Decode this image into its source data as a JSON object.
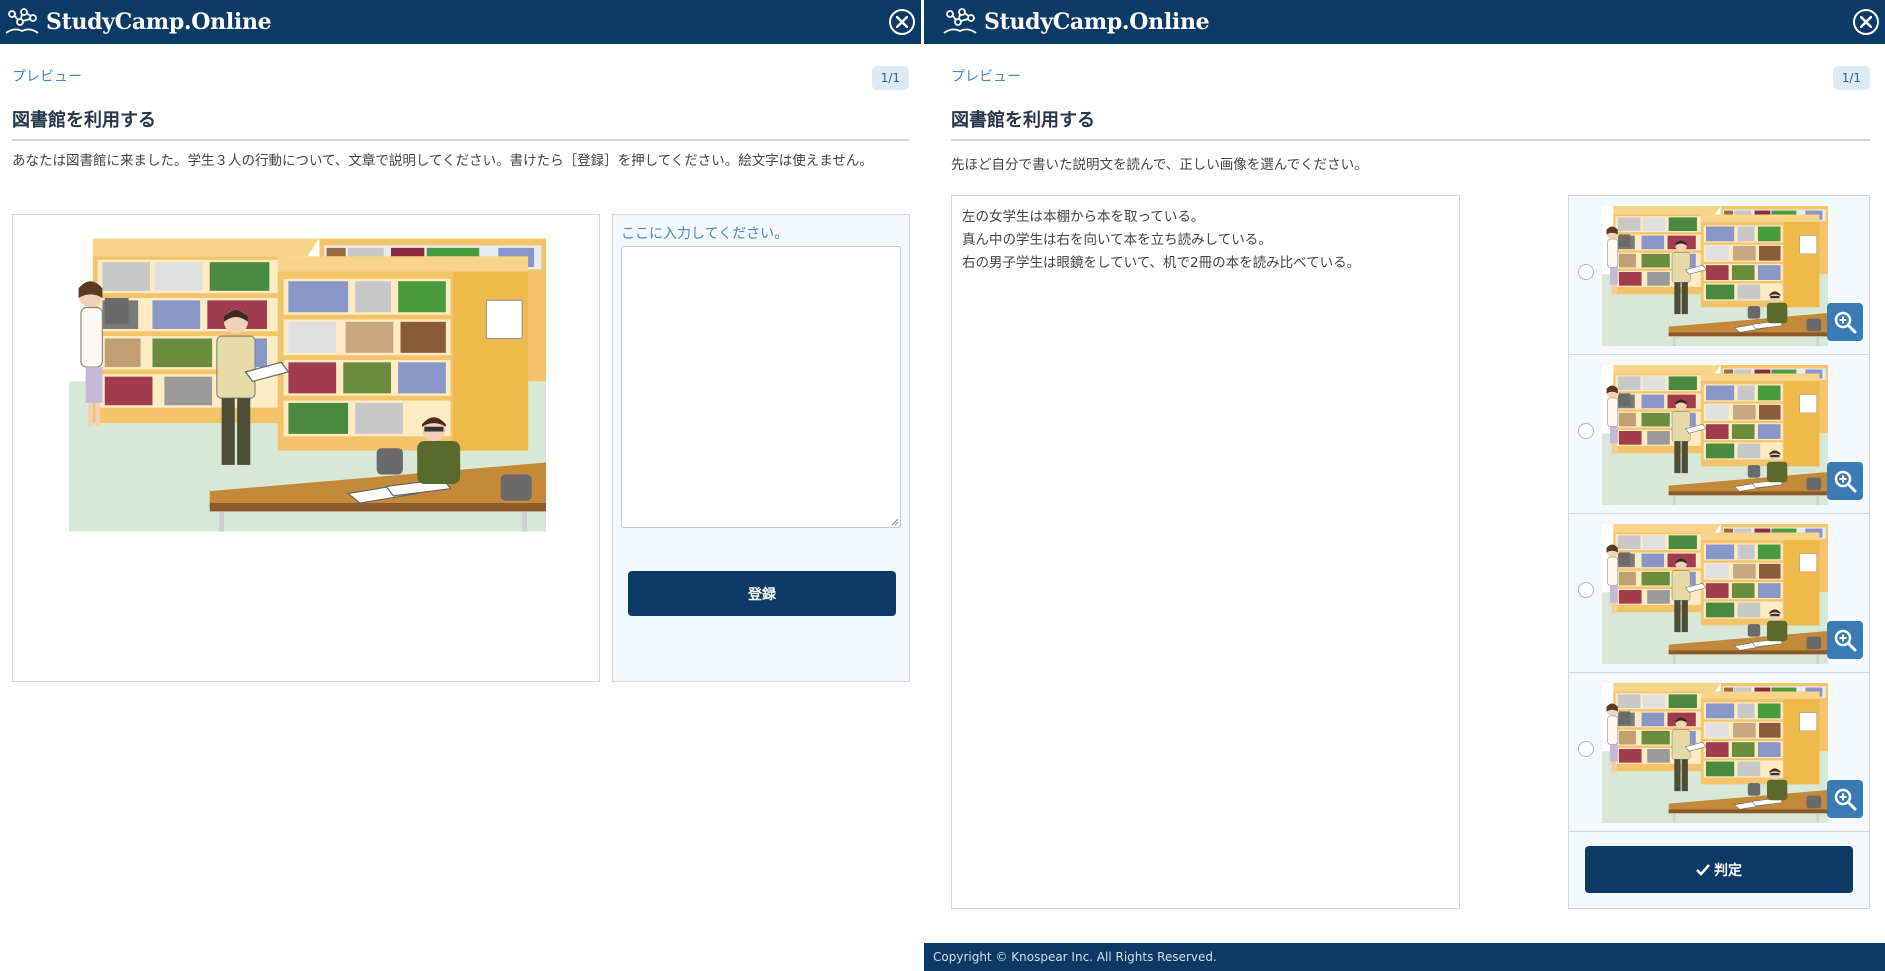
{
  "app": {
    "brand": "StudyCamp.Online"
  },
  "left": {
    "breadcrumb": "プレビュー",
    "pager": "1/1",
    "title": "図書館を利用する",
    "instruction": "あなたは図書館に来ました。学生３人の行動について、文章で説明してください。書けたら［登録］を押してください。絵文字は使えません。",
    "input_label": "ここに入力してください。",
    "answer_value": "",
    "submit_label": "登録"
  },
  "right": {
    "breadcrumb": "プレビュー",
    "pager": "1/1",
    "title": "図書館を利用する",
    "instruction": "先ほど自分で書いた説明文を読んで、正しい画像を選んでください。",
    "description_lines": [
      "左の女学生は本棚から本を取っている。",
      "真ん中の学生は右を向いて本を立ち読みしている。",
      "右の男子学生は眼鏡をしていて、机で2冊の本を読み比べている。"
    ],
    "choices": [
      {
        "selected": false
      },
      {
        "selected": false
      },
      {
        "selected": false
      },
      {
        "selected": false
      }
    ],
    "judge_label": "判定",
    "footer": "Copyright © Knospear Inc. All Rights Reserved."
  },
  "colors": {
    "header_bg": "#0c3a66",
    "link_blue": "#4a86c5",
    "zoom_blue": "#3b7bb4",
    "input_panel_bg": "#f3f8fd"
  },
  "icons": {
    "brand": "network-logo-icon",
    "close": "close-circle-icon",
    "zoom": "zoom-in-icon",
    "check": "check-icon"
  }
}
